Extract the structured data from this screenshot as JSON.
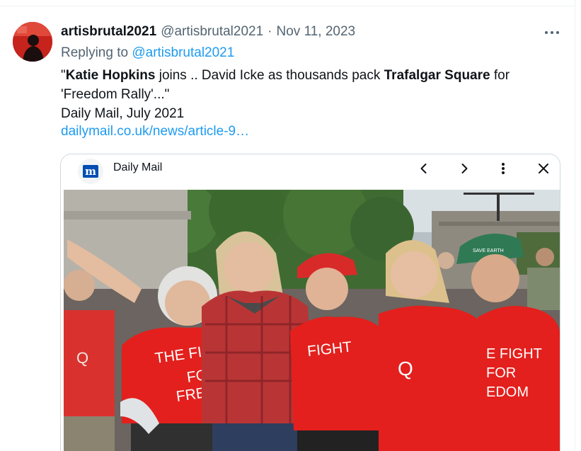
{
  "tweet": {
    "display_name": "artisbrutal2021",
    "handle": "@artisbrutal2021",
    "separator": "·",
    "date": "Nov 11, 2023",
    "replying_to_prefix": "Replying to ",
    "replying_to_handle": "@artisbrutal2021",
    "text": {
      "l1_a": "\"",
      "l1_b": "Katie Hopkins",
      "l1_c": " joins .. David Icke as thousands pack ",
      "l1_d": "Trafalgar Square",
      "l1_e": " for",
      "l2": "'Freedom Rally'...\"",
      "l3": "Daily Mail, July 2021"
    },
    "link": "dailymail.co.uk/news/article-9…"
  },
  "card": {
    "source_name": "Daily Mail",
    "source_logo_letter": "m",
    "icons": [
      "chevron-left-icon",
      "chevron-right-icon",
      "more-vertical-icon",
      "close-icon"
    ]
  },
  "photo": {
    "shirt_texts": {
      "woman1": [
        "THE FIGHT",
        "FOR",
        "FREEDOM"
      ],
      "woman3": [
        "FIGHT"
      ],
      "woman5": [
        "E FIGHT",
        "FOR",
        "EDOM"
      ],
      "man_left": "Q",
      "woman4_logo": "Q",
      "cap_text": "SAVE EARTH"
    }
  },
  "colors": {
    "text_primary": "#0f1419",
    "text_secondary": "#536471",
    "link": "#1d9bf0",
    "border": "#cfd9de",
    "dailymail_blue": "#004db3",
    "shirt_red": "#e0201e"
  }
}
